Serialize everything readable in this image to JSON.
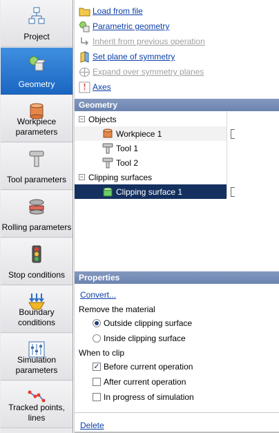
{
  "sidebar": {
    "items": [
      {
        "label": "Project",
        "icon": "project-icon",
        "active": false
      },
      {
        "label": "Geometry",
        "icon": "geometry-icon",
        "active": true
      },
      {
        "label": "Workpiece parameters",
        "icon": "workpiece-icon",
        "active": false
      },
      {
        "label": "Tool parameters",
        "icon": "tool-icon",
        "active": false
      },
      {
        "label": "Rolling parameters",
        "icon": "rolling-icon",
        "active": false
      },
      {
        "label": "Stop conditions",
        "icon": "traffic-light-icon",
        "active": false
      },
      {
        "label": "Boundary conditions",
        "icon": "boundary-icon",
        "active": false
      },
      {
        "label": "Simulation parameters",
        "icon": "simulation-icon",
        "active": false
      },
      {
        "label": "Tracked points, lines",
        "icon": "tracked-points-icon",
        "active": false
      }
    ]
  },
  "toolbar": {
    "load_from_file": "Load from file",
    "parametric_geometry": "Parametric geometry",
    "inherit_previous": "Inherit from previous operation",
    "set_symmetry_plane": "Set plane of symmetry",
    "expand_symmetry": "Expand over symmetry planes",
    "axes": "Axes"
  },
  "geometry": {
    "header": "Geometry",
    "objects_label": "Objects",
    "workpiece": "Workpiece 1",
    "tool1": "Tool 1",
    "tool2": "Tool 2",
    "clipping_label": "Clipping surfaces",
    "clipping1": "Clipping surface 1"
  },
  "properties": {
    "header": "Properties",
    "convert": "Convert...",
    "remove_material": "Remove the material",
    "outside": "Outside clipping surface",
    "inside": "Inside clipping surface",
    "outside_selected": true,
    "when_to_clip": "When to clip",
    "before": "Before current operation",
    "before_checked": true,
    "after": "After current operation",
    "after_checked": false,
    "in_progress": "In progress of simulation",
    "in_progress_checked": false,
    "delete": "Delete"
  },
  "colors": {
    "accent": "#1a66c2",
    "header": "#7088b4",
    "selection": "#14305f",
    "link": "#0b3ea8"
  }
}
